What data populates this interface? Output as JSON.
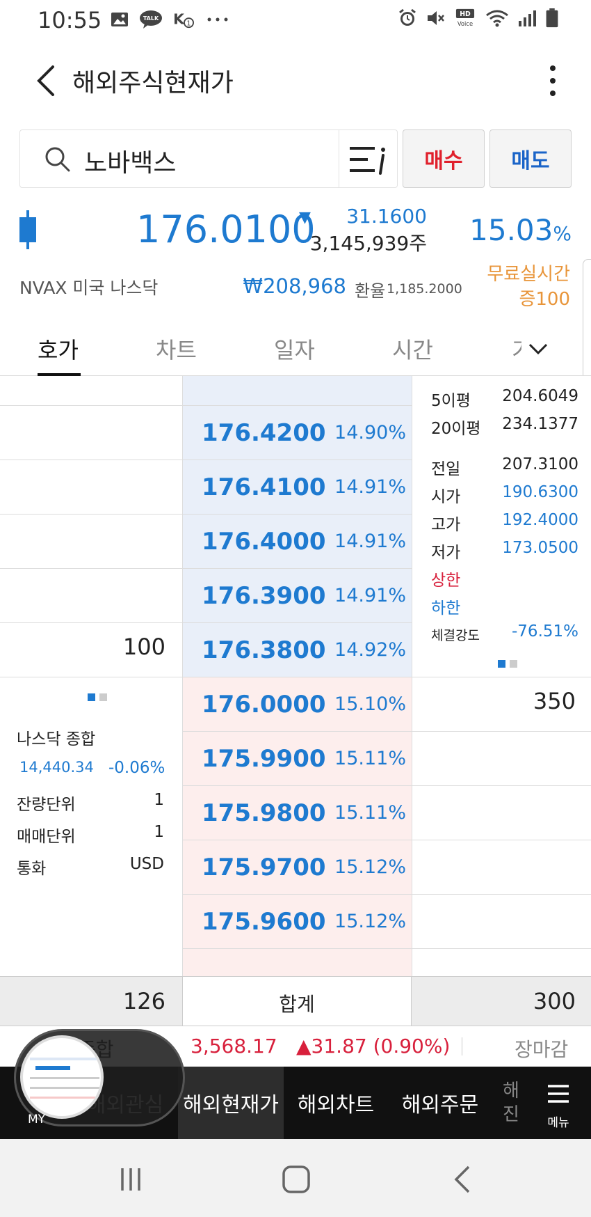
{
  "status_bar": {
    "time": "10:55",
    "left_icons": [
      "image-icon",
      "talk-icon",
      "vpn-key-icon",
      "more-dots-icon"
    ],
    "right_icons": [
      "alarm-icon",
      "mute-icon",
      "hd-voice-icon",
      "wifi-icon",
      "signal-icon",
      "battery-icon"
    ]
  },
  "header": {
    "title": "해외주식현재가"
  },
  "search": {
    "value": "노바백스",
    "buy_label": "매수",
    "sell_label": "매도"
  },
  "quote": {
    "price": "176.0100",
    "change": "31.1600",
    "volume": "3,145,939주",
    "change_pct": "15.03",
    "pct_sign": "%",
    "ticker": "NVAX  미국 나스닥",
    "krw_price": "₩208,968",
    "fx_label": "환율",
    "fx_value": "1,185.2000",
    "realtime_line1": "무료실시간",
    "realtime_line2": "증100"
  },
  "tabs": [
    {
      "label": "호가"
    },
    {
      "label": "차트"
    },
    {
      "label": "일자"
    },
    {
      "label": "시간"
    },
    {
      "label": "기"
    }
  ],
  "order_book": {
    "asks": [
      {
        "price": "176.4200",
        "pct": "14.90%",
        "qty": ""
      },
      {
        "price": "176.4100",
        "pct": "14.91%",
        "qty": ""
      },
      {
        "price": "176.4000",
        "pct": "14.91%",
        "qty": ""
      },
      {
        "price": "176.3900",
        "pct": "14.91%",
        "qty": ""
      },
      {
        "price": "176.3800",
        "pct": "14.92%",
        "qty": "100"
      }
    ],
    "bids": [
      {
        "price": "176.0000",
        "pct": "15.10%",
        "qty": "350"
      },
      {
        "price": "175.9900",
        "pct": "15.11%",
        "qty": ""
      },
      {
        "price": "175.9800",
        "pct": "15.11%",
        "qty": ""
      },
      {
        "price": "175.9700",
        "pct": "15.12%",
        "qty": ""
      },
      {
        "price": "175.9600",
        "pct": "15.12%",
        "qty": ""
      }
    ]
  },
  "stats": {
    "ma5_label": "5이평",
    "ma5": "204.6049",
    "ma20_label": "20이평",
    "ma20": "234.1377",
    "prev_label": "전일",
    "prev": "207.3100",
    "open_label": "시가",
    "open": "190.6300",
    "high_label": "고가",
    "high": "192.4000",
    "low_label": "저가",
    "low": "173.0500",
    "upper_label": "상한",
    "lower_label": "하한",
    "strength_label": "체결강도",
    "strength": "-76.51%"
  },
  "market_info": {
    "index_label": "나스닥 종합",
    "index_value": "14,440.34",
    "index_change": "-0.06%",
    "remain_unit_label": "잔량단위",
    "remain_unit": "1",
    "trade_unit_label": "매매단위",
    "trade_unit": "1",
    "currency_label": "통화",
    "currency": "USD"
  },
  "totals": {
    "ask_total": "126",
    "label": "합계",
    "bid_total": "300"
  },
  "ticker_bar": {
    "label": "종합",
    "value": "3,568.17",
    "change": "▲31.87 (0.90%)",
    "status": "장마감"
  },
  "bottom_nav": {
    "items": [
      "해외관심",
      "해외현재가",
      "해외차트",
      "해외주문"
    ],
    "partial_item": "해\n진",
    "menu_label": "메뉴",
    "my_label": "MY"
  },
  "colors": {
    "up": "#d8203c",
    "down": "#1e7ad0",
    "ask_bg": "#e9eff9",
    "bid_bg": "#fdeeed",
    "accent_orange": "#e8953a"
  }
}
